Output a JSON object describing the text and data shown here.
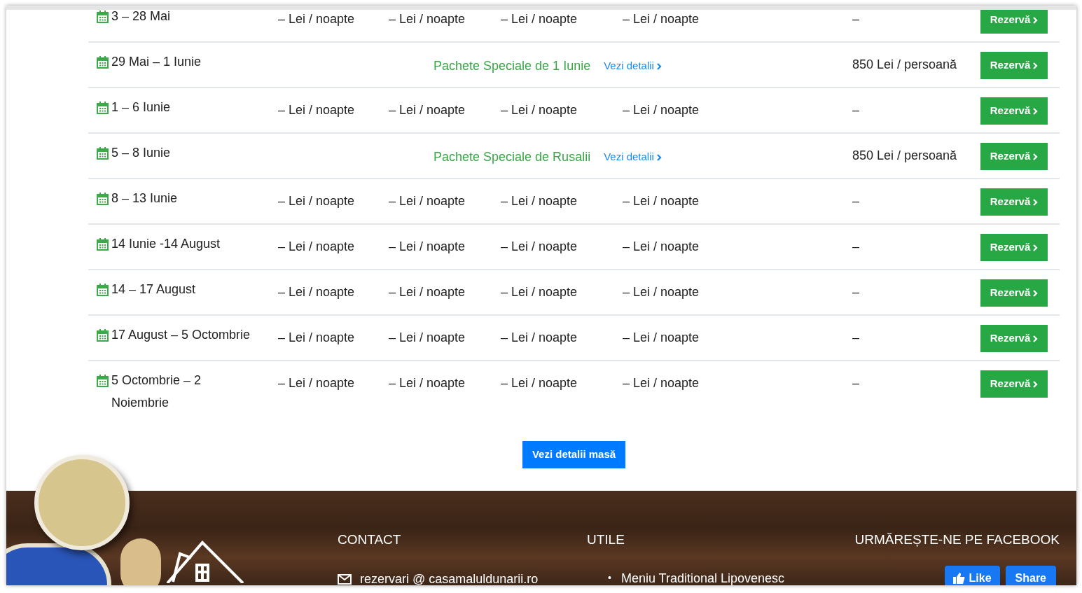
{
  "rows": [
    {
      "kind": "prices",
      "date": "3 – 28 Mai",
      "prices": [
        "– Lei / noapte",
        "– Lei / noapte",
        "– Lei / noapte",
        "– Lei / noapte"
      ],
      "extra": "–",
      "button": "Rezervă"
    },
    {
      "kind": "package",
      "date": "29 Mai – 1 Iunie",
      "package": "Pachete Speciale de 1 Iunie",
      "link": "Vezi detalii",
      "extra": "850 Lei / persoană",
      "button": "Rezervă"
    },
    {
      "kind": "prices",
      "date": "1 – 6 Iunie",
      "prices": [
        "– Lei / noapte",
        "– Lei / noapte",
        "– Lei / noapte",
        "– Lei / noapte"
      ],
      "extra": "–",
      "button": "Rezervă"
    },
    {
      "kind": "package",
      "date": "5 – 8 Iunie",
      "package": "Pachete Speciale de Rusalii",
      "link": "Vezi detalii",
      "extra": "850 Lei / persoană",
      "button": "Rezervă"
    },
    {
      "kind": "prices",
      "date": "8 – 13 Iunie",
      "prices": [
        "– Lei / noapte",
        "– Lei / noapte",
        "– Lei / noapte",
        "– Lei / noapte"
      ],
      "extra": "–",
      "button": "Rezervă"
    },
    {
      "kind": "prices",
      "date": "14 Iunie -14 August",
      "prices": [
        "– Lei / noapte",
        "– Lei / noapte",
        "– Lei / noapte",
        "– Lei / noapte"
      ],
      "extra": "–",
      "button": "Rezervă"
    },
    {
      "kind": "prices",
      "date": "14 – 17 August",
      "prices": [
        "– Lei / noapte",
        "– Lei / noapte",
        "– Lei / noapte",
        "– Lei / noapte"
      ],
      "extra": "–",
      "button": "Rezervă"
    },
    {
      "kind": "prices",
      "date": "17 August – 5 Octombrie",
      "prices": [
        "– Lei / noapte",
        "– Lei / noapte",
        "– Lei / noapte",
        "– Lei / noapte"
      ],
      "extra": "–",
      "button": "Rezervă"
    },
    {
      "kind": "prices",
      "date": "5 Octombrie – 2 Noiembrie",
      "prices": [
        "– Lei / noapte",
        "– Lei / noapte",
        "– Lei / noapte",
        "– Lei / noapte"
      ],
      "extra": "–",
      "button": "Rezervă"
    }
  ],
  "details_button": "Vezi detalii masă",
  "footer": {
    "contact": {
      "heading": "CONTACT",
      "email": "rezervari @ casamaluldunarii.ro"
    },
    "useful": {
      "heading": "UTILE",
      "items": [
        {
          "bullet": "•",
          "text": "Meniu Traditional Lipovenesc"
        }
      ]
    },
    "facebook": {
      "heading": "URMĂREȘTE-NE PE FACEBOOK",
      "like": "Like",
      "share": "Share"
    }
  }
}
